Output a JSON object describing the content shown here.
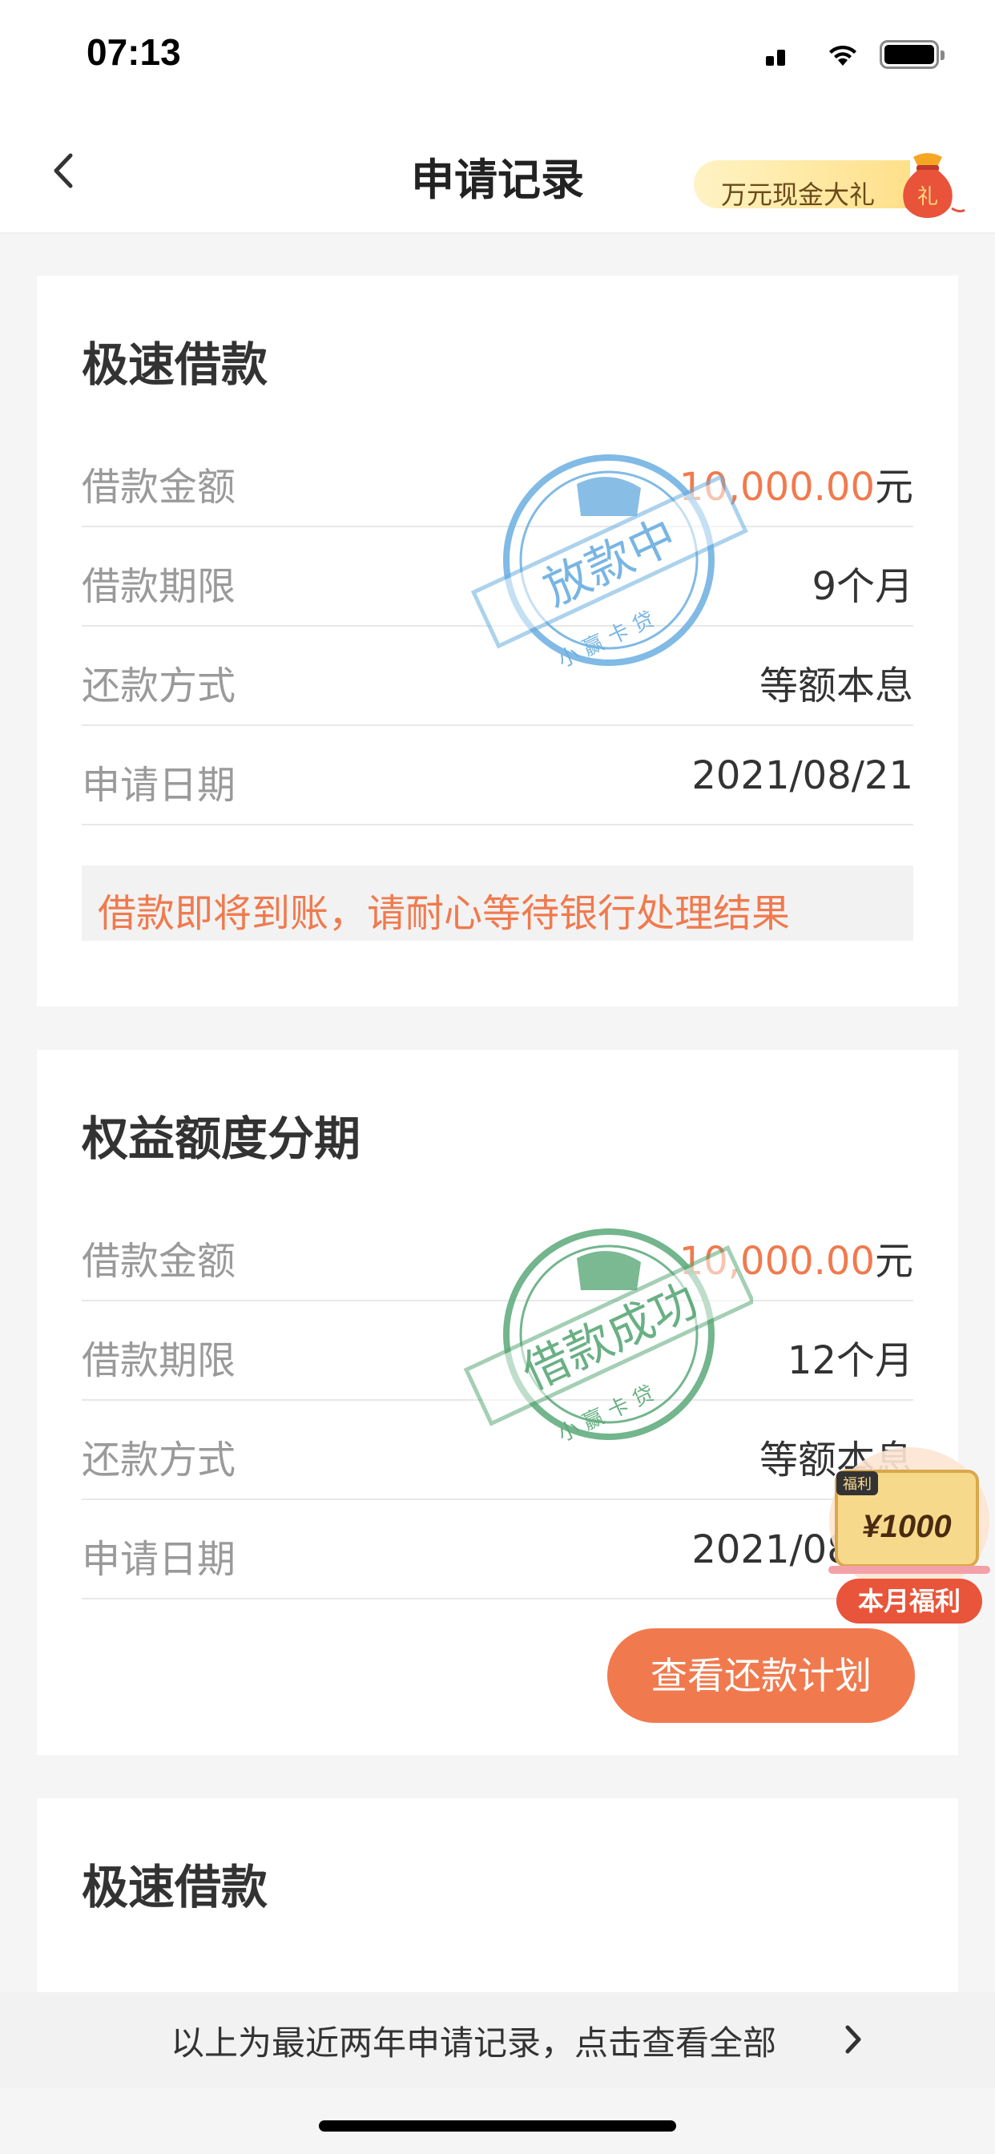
{
  "status_bar": {
    "time": "07:13"
  },
  "nav": {
    "title": "申请记录",
    "promo_text": "万元现金大礼",
    "promo_bag_char": "礼"
  },
  "colors": {
    "accent": "#f07a4e",
    "stamp_blue": "#6aaee0",
    "stamp_green": "#5aa878"
  },
  "cards": [
    {
      "title": "极速借款",
      "rows": [
        {
          "label": "借款金额",
          "value": "10,000.00",
          "unit": "元"
        },
        {
          "label": "借款期限",
          "value": "9个月"
        },
        {
          "label": "还款方式",
          "value": "等额本息"
        },
        {
          "label": "申请日期",
          "value": "2021/08/21"
        }
      ],
      "notice": "借款即将到账，请耐心等待银行处理结果",
      "stamp": {
        "main": "放款中",
        "sub": "小 赢 卡 贷"
      }
    },
    {
      "title": "权益额度分期",
      "rows": [
        {
          "label": "借款金额",
          "value": "10,000.00",
          "unit": "元"
        },
        {
          "label": "借款期限",
          "value": "12个月"
        },
        {
          "label": "还款方式",
          "value": "等额本息"
        },
        {
          "label": "申请日期",
          "value": "2021/08/21"
        }
      ],
      "button": "查看还款计划",
      "stamp": {
        "main": "借款成功",
        "sub": "小 赢 卡 贷"
      }
    },
    {
      "title": "极速借款"
    }
  ],
  "welfare_badge": {
    "tag": "福利",
    "amount": "¥1000",
    "label": "本月福利"
  },
  "footer": {
    "text": "以上为最近两年申请记录，点击查看全部"
  }
}
